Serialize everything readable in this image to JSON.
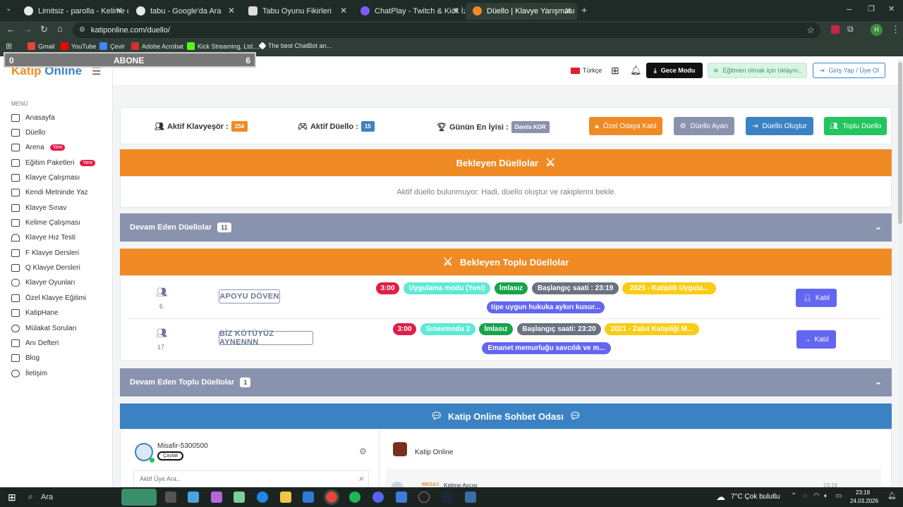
{
  "browser": {
    "tabs": [
      {
        "title": "Limitsiz - parolla - Kelime oyunu",
        "active": false
      },
      {
        "title": "tabu - Google'da Ara",
        "active": false
      },
      {
        "title": "Tabu Oyunu Fikirleri",
        "active": false
      },
      {
        "title": "ChatPlay - Twitch & Kick İzleyici",
        "active": false
      },
      {
        "title": "Düello | Klavye Yarışması - Katip",
        "active": true
      }
    ],
    "url": "katiponline.com/duello/",
    "profile_initial": "H",
    "bookmarks": [
      {
        "label": "Gmail",
        "color": "#ea4335"
      },
      {
        "label": "YouTube",
        "color": "#ff0000"
      },
      {
        "label": "Çevir",
        "color": "#4285f4"
      },
      {
        "label": "Adobe Acrobat",
        "color": "#d32f2f"
      },
      {
        "label": "Kick Streaming, Ltd....",
        "color": "#53fc18"
      },
      {
        "label": "The best ChatBot an...",
        "color": "#ffffff"
      }
    ]
  },
  "overlay": {
    "left": "0",
    "title": "ABONE",
    "right": "6"
  },
  "site": {
    "logo_part1": "Katip",
    "logo_part2": "Online",
    "menu_heading": "MENÜ",
    "menu": [
      {
        "label": "Anasayfa",
        "icon": "home-icon"
      },
      {
        "label": "Düello",
        "icon": "swords-icon"
      },
      {
        "label": "Arena",
        "icon": "arena-icon",
        "badge": "Yeni"
      },
      {
        "label": "Eğitim Paketleri",
        "icon": "cart-icon",
        "badge": "Yeni"
      },
      {
        "label": "Klavye Çalışması",
        "icon": "keyboard-icon"
      },
      {
        "label": "Kendi Metninde Yaz",
        "icon": "keyboard-icon"
      },
      {
        "label": "Klavye Sınav",
        "icon": "keyboard-icon"
      },
      {
        "label": "Kelime Çalışması",
        "icon": "keyboard-icon"
      },
      {
        "label": "Klavye Hız Testi",
        "icon": "gauge-icon"
      },
      {
        "label": "F Klavye Dersleri",
        "icon": "f-icon"
      },
      {
        "label": "Q Klavye Dersleri",
        "icon": "q-icon"
      },
      {
        "label": "Klavye Oyunları",
        "icon": "gamepad-icon"
      },
      {
        "label": "Özel Klavye Eğitimi",
        "icon": "book-icon"
      },
      {
        "label": "KatipHane",
        "icon": "building-icon"
      },
      {
        "label": "Mülakat Soruları",
        "icon": "question-icon"
      },
      {
        "label": "Anı Defteri",
        "icon": "pen-icon"
      },
      {
        "label": "Blog",
        "icon": "b-icon"
      },
      {
        "label": "İletişim",
        "icon": "info-icon"
      }
    ],
    "header": {
      "language": "Türkçe",
      "night_mode": "Gece Modu",
      "instructor": "Eğitmen olmak için tıklayın..",
      "login": "Giriş Yap / Üye Ol"
    },
    "stats": {
      "active_typists_label": "Aktif Klavyeşör :",
      "active_typists": "254",
      "active_duels_label": "Aktif Düello :",
      "active_duels": "15",
      "best_label": "Günün En İyisi :",
      "best": "Damla KOR"
    },
    "actions": {
      "private_room": "Özel Odaya Katıl",
      "settings": "Düello Ayarı",
      "create": "Düello Oluştur",
      "group": "Toplu Düello"
    },
    "waiting_duels": {
      "title": "Bekleyen Düellolar",
      "empty": "Aktif düello bulunmuyor. Hadi, düello oluştur ve rakiplerini bekle."
    },
    "ongoing_duels": {
      "title": "Devam Eden Düellolar",
      "count": "11"
    },
    "waiting_group": {
      "title": "Bekleyen Toplu Düellolar",
      "rooms": [
        {
          "players": "6",
          "name": "APOYU DÖVEN",
          "time": "3:00",
          "mode": "Uygulama modu (Yeni)",
          "spell": "İmlasız",
          "start": "Başlangıç saati : 23:19",
          "text": "2025 - Katiplik Uygula...",
          "text2": "tipe uygun hukuka aykırı kusur...",
          "join": "Katıl"
        },
        {
          "players": "17",
          "name": "BİZ KÖTÜYÜZ AYNENNN",
          "time": "3:00",
          "mode": "Sınavmodu 2",
          "spell": "İmlasız",
          "start": "Başlangıç saati: 23:20",
          "text": "2021 - Zabıt Katipliği M...",
          "text2": "Emanet memurluğu savcılık ve m...",
          "join": "Katıl"
        }
      ]
    },
    "ongoing_group": {
      "title": "Devam Eden Toplu Düellolar",
      "count": "1"
    },
    "chat": {
      "title": "Katip Online Sohbet Odası",
      "user": "Misafir-5300500",
      "rank": "Çaylak",
      "search_placeholder": "Aktif Üye Ara..",
      "room": "Katip Online",
      "msg_tag": "MESAJ",
      "msg_user": "Kelime Avcısı",
      "msg_time": "23:18"
    }
  },
  "taskbar": {
    "search": "Ara",
    "weather": "7°C  Çok bulutlu",
    "time": "23:18",
    "date": "24.03.2026"
  },
  "colors": {
    "orange": "#f08a24",
    "slate": "#8a93ad",
    "blue": "#3b82c4",
    "green": "#22c55e",
    "indigo": "#6366f1",
    "red": "#e11d48"
  }
}
